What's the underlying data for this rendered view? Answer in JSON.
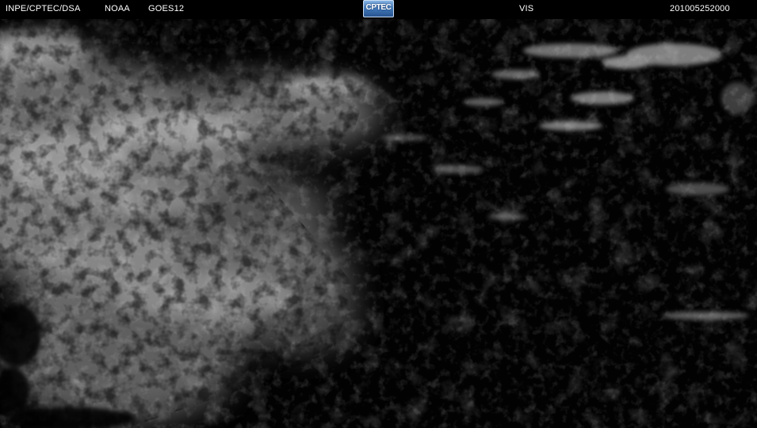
{
  "header": {
    "agency": "INPE/CPTEC/DSA",
    "source": "NOAA",
    "satellite": "GOES12",
    "logo_text": "CPTEC",
    "channel": "VIS",
    "timestamp": "201005252000"
  },
  "imagery": {
    "type": "satellite-visible-channel",
    "background_color": "#000000",
    "cloud_color": "#ffffff"
  }
}
